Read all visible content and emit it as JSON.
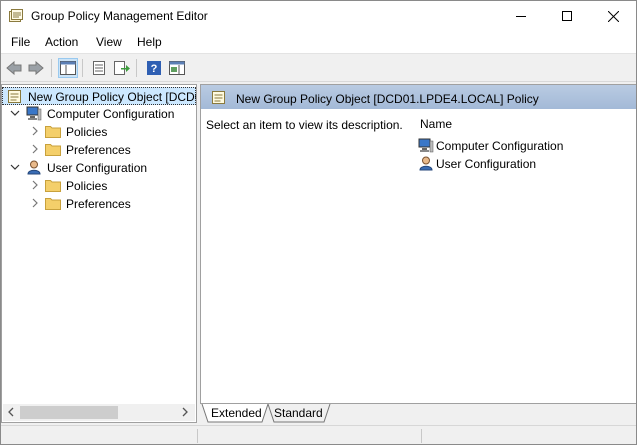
{
  "window": {
    "title": "Group Policy Management Editor",
    "controls": {
      "minimize": "minimize-icon",
      "maximize": "maximize-icon",
      "close": "close-icon"
    }
  },
  "menu": [
    "File",
    "Action",
    "View",
    "Help"
  ],
  "toolbar": {
    "buttons": [
      "back-arrow-icon",
      "forward-arrow-icon",
      "show-hide-console-tree-icon",
      "properties-icon",
      "export-list-icon",
      "help-icon",
      "action-pane-icon"
    ]
  },
  "tree": {
    "root": "New Group Policy Object [DCD01.LPDE4.LOCAL] Policy",
    "computer_config": {
      "label": "Computer Configuration",
      "children": [
        "Policies",
        "Preferences"
      ]
    },
    "user_config": {
      "label": "User Configuration",
      "children": [
        "Policies",
        "Preferences"
      ]
    }
  },
  "details": {
    "header": "New Group Policy Object [DCD01.LPDE4.LOCAL] Policy",
    "description": "Select an item to view its description.",
    "column_name": "Name",
    "items": [
      "Computer Configuration",
      "User Configuration"
    ]
  },
  "tabs": [
    "Extended",
    "Standard"
  ],
  "colors": {
    "selection": "#cce8ff",
    "header_band": "#aec2dd",
    "pressed": "#cce4f7"
  }
}
